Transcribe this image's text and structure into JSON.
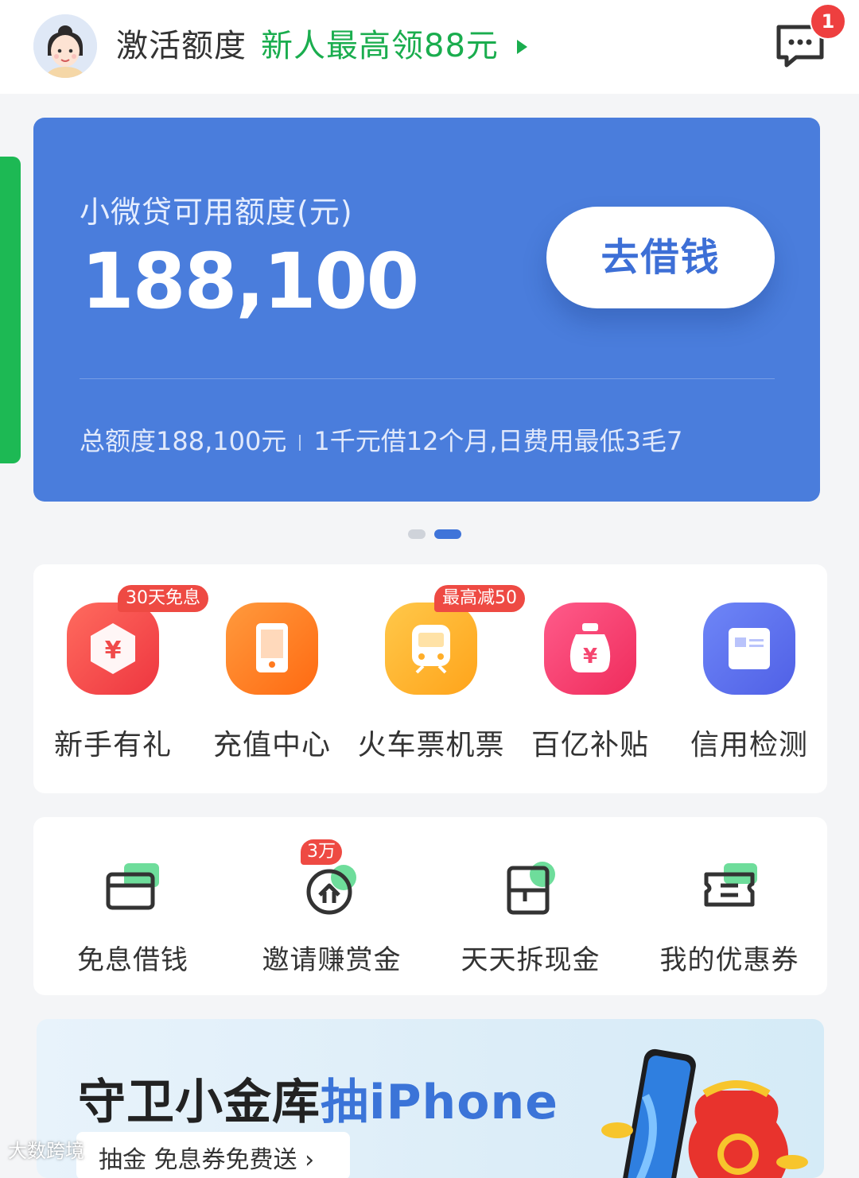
{
  "header": {
    "title": "激活额度",
    "promo": "新人最高领88元",
    "message_badge": "1"
  },
  "credit_card": {
    "label": "小微贷可用额度(元)",
    "amount": "188,100",
    "borrow_button": "去借钱",
    "total_quota": "总额度188,100元",
    "fee_note": "1千元借12个月,日费用最低3毛7"
  },
  "services": [
    {
      "label": "新手有礼",
      "tag": "30天免息",
      "color": "#f0474a"
    },
    {
      "label": "充值中心",
      "tag": "",
      "color": "#ff7d1f"
    },
    {
      "label": "火车票机票",
      "tag": "最高减50",
      "color": "#ffb22e"
    },
    {
      "label": "百亿补贴",
      "tag": "",
      "color": "#f7386b"
    },
    {
      "label": "信用检测",
      "tag": "",
      "color": "#5b6ef0"
    }
  ],
  "quick_actions": [
    {
      "label": "免息借钱",
      "tag": ""
    },
    {
      "label": "邀请赚赏金",
      "tag": "3万"
    },
    {
      "label": "天天拆现金",
      "tag": ""
    },
    {
      "label": "我的优惠券",
      "tag": ""
    }
  ],
  "banner": {
    "title_main": "守卫小金库",
    "title_highlight": "抽iPhone",
    "subtitle": "抽金 免息券免费送 ›"
  },
  "watermark": "大数跨境",
  "colors": {
    "accent_green": "#1aad4e",
    "card_blue": "#4a7ddc",
    "badge_red": "#ee3f3f"
  }
}
